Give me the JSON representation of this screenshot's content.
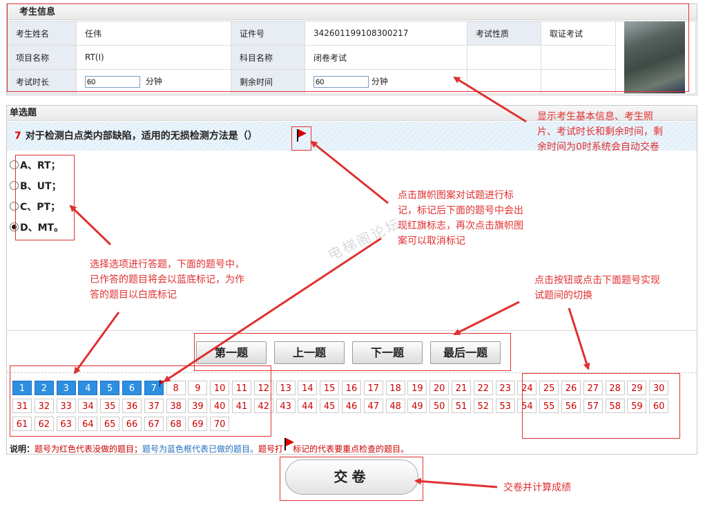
{
  "info": {
    "title": "考生信息",
    "labels": {
      "name": "考生姓名",
      "id_no": "证件号",
      "exam_type": "考试性质",
      "project": "项目名称",
      "subject": "科目名称",
      "duration": "考试时长",
      "remaining": "剩余时间"
    },
    "values": {
      "name": "任伟",
      "id_no": "342601199108300217",
      "exam_type": "取证考试",
      "project": "RT(Ⅰ)",
      "subject": "闭卷考试",
      "duration": "60",
      "remaining": "60"
    },
    "unit": "分钟"
  },
  "question": {
    "section": "单选题",
    "number": "7",
    "text": "对于检测白点类内部缺陷，适用的无损检测方法是（）",
    "options": [
      "A、RT；",
      "B、UT；",
      "C、PT；",
      "D、MT。"
    ],
    "selected_index": 3
  },
  "nav": {
    "first": "第一题",
    "prev": "上一题",
    "next": "下一题",
    "last": "最后一题"
  },
  "numbers": {
    "row1": [
      "1",
      "2",
      "3",
      "4",
      "5",
      "6",
      "7",
      "8",
      "9",
      "10",
      "11",
      "12",
      "13",
      "14",
      "15",
      "16",
      "17",
      "18",
      "19",
      "20",
      "21",
      "22",
      "23",
      "24",
      "25",
      "26",
      "27",
      "28",
      "29",
      "30"
    ],
    "row2": [
      "31",
      "32",
      "33",
      "34",
      "35",
      "36",
      "37",
      "38",
      "39",
      "40",
      "41",
      "42",
      "43",
      "44",
      "45",
      "46",
      "47",
      "48",
      "49",
      "50",
      "51",
      "52",
      "53",
      "54",
      "55",
      "56",
      "57",
      "58",
      "59",
      "60"
    ],
    "row3": [
      "61",
      "62",
      "63",
      "64",
      "65",
      "66",
      "67",
      "68",
      "69",
      "70"
    ],
    "answered_count": 7,
    "flagged": [
      "7"
    ]
  },
  "legend": {
    "prefix": "说明：",
    "red": "题号为红色代表没做的题目；",
    "blue": "题号为蓝色框代表已做的题目。",
    "flag_a": "题号打",
    "flag_b": "标记的代表要重点检查的题目。"
  },
  "submit_label": "交卷",
  "watermark": "电梯阁论坛",
  "annotations": {
    "info_note": "显示考生基本信息、考生照片、考试时长和剩余时间，剩余时间为0时系统会自动交卷",
    "flag_note": "点击旗帜图案对试题进行标记，标记后下面的题号中会出现红旗标志，再次点击旗帜图案可以取消标记",
    "option_note": "选择选项进行答题，下面的题号中，已作答的题目将会以蓝底标记，为作答的题目以白底标记",
    "nav_note": "点击按钮或点击下面题号实现试题间的切换",
    "submit_note": "交卷并计算成绩"
  },
  "colors": {
    "annotation": "#e03030",
    "answered": "#2d8fe0",
    "unanswered_text": "#c00",
    "question_bg": "#e3f0f9"
  }
}
